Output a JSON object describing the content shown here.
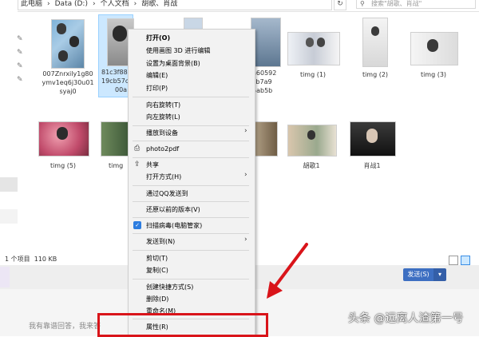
{
  "window": {
    "address": {
      "parts": [
        "此电脑",
        "›",
        "Data (D:)",
        "›",
        "个人文档",
        "›",
        "胡歌、肖战"
      ],
      "refresh_icon": "refresh-icon"
    },
    "search_placeholder": "搜索\"胡歌、肖战\""
  },
  "files": [
    {
      "name": "007Znrxily1g80ymv1eq6j30u01syaj0",
      "line1": "007Znrxily1g80",
      "line2": "ymv1eq6j30u01",
      "line3": "syaj0"
    },
    {
      "name": "81c3f88…19cb57c…00a",
      "line1": "81c3f88",
      "line2": "19cb57c",
      "line3": "00a",
      "selected": true
    },
    {
      "name": "…a60592 cb7a9 5ab5b 7",
      "line1": "a60592",
      "line2": "cb7a9",
      "line3": "5ab5b"
    },
    {
      "name": "timg (1)",
      "line1": "timg (1)"
    },
    {
      "name": "timg (2)",
      "line1": "timg (2)"
    },
    {
      "name": "timg (3)",
      "line1": "timg (3)"
    },
    {
      "name": "timg (5)",
      "line1": "timg (5)"
    },
    {
      "name": "timg",
      "line1": "timg"
    },
    {
      "name": "胡歌1",
      "line1": "胡歌1"
    },
    {
      "name": "肖战1",
      "line1": "肖战1"
    }
  ],
  "status": {
    "count": "1 个项目",
    "size": "110 KB"
  },
  "context_menu": {
    "items": [
      {
        "label": "打开(O)",
        "bold": true
      },
      {
        "label": "使用画图 3D 进行编辑"
      },
      {
        "label": "设置为桌面背景(B)"
      },
      {
        "label": "编辑(E)"
      },
      {
        "label": "打印(P)"
      },
      {
        "label": "向右旋转(T)"
      },
      {
        "label": "向左旋转(L)"
      },
      {
        "label": "播放到设备"
      },
      {
        "label": "photo2pdf"
      },
      {
        "label": "共享"
      },
      {
        "label": "打开方式(H)"
      },
      {
        "label": "通过QQ发送到"
      },
      {
        "label": "还原以前的版本(V)"
      },
      {
        "label": "扫描病毒(电脑管家)"
      },
      {
        "label": "发送到(N)"
      },
      {
        "label": "剪切(T)"
      },
      {
        "label": "复制(C)"
      },
      {
        "label": "创建快捷方式(S)"
      },
      {
        "label": "删除(D)"
      },
      {
        "label": "重命名(M)"
      },
      {
        "label": "属性(R)"
      }
    ]
  },
  "chat": {
    "send_label": "发送(S)",
    "send_dropdown": "▾",
    "reply_hint": "我有靠谱回答，我来答"
  },
  "watermark": "头条 @远离人渣第一号",
  "colors": {
    "highlight": "#d9141a",
    "selection": "#cce8ff",
    "send_button": "#3d6fc2"
  }
}
